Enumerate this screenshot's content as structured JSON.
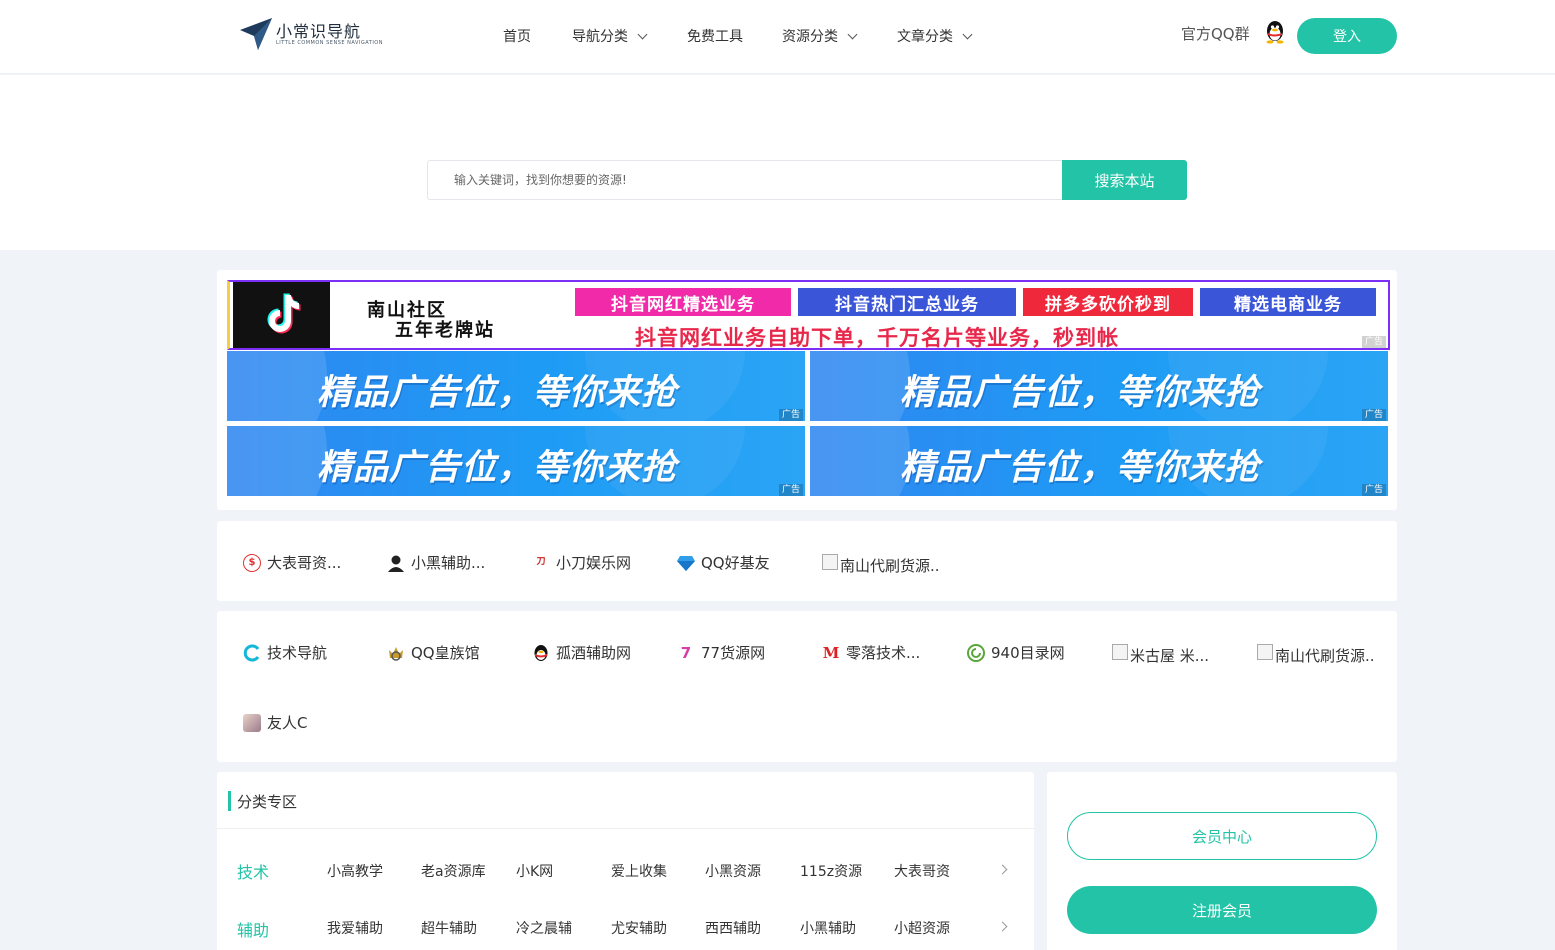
{
  "header": {
    "logo_title": "小常识导航",
    "logo_sub": "LITTLE COMMON SENSE NAVIGATION",
    "nav": [
      {
        "label": "首页"
      },
      {
        "label": "导航分类"
      },
      {
        "label": "免费工具"
      },
      {
        "label": "资源分类"
      },
      {
        "label": "文章分类"
      }
    ],
    "qq_group": "官方QQ群",
    "login": "登入"
  },
  "search": {
    "placeholder": "输入关键词，找到你想要的资源!",
    "button": "搜索本站"
  },
  "ads": {
    "top": {
      "title1": "南山社区",
      "title2": "五年老牌站",
      "tags": [
        "抖音网红精选业务",
        "抖音热门汇总业务",
        "拼多多砍价秒到",
        "精选电商业务"
      ],
      "slogan": "抖音网红业务自助下单，千万名片等业务，秒到帐",
      "tag_colors": [
        "#f02aa8",
        "#3b55d9",
        "#f0283c",
        "#3b55d9"
      ]
    },
    "ad_label": "广告",
    "banners": [
      "精品广告位，等你来抢",
      "精品广告位，等你来抢",
      "精品广告位，等你来抢",
      "精品广告位，等你来抢"
    ]
  },
  "links_featured": [
    {
      "name": "大表哥资...",
      "icon": "coin-icon"
    },
    {
      "name": "小黑辅助...",
      "icon": "hacker-icon"
    },
    {
      "name": "小刀娱乐网",
      "icon": "xiaodao-icon"
    },
    {
      "name": "QQ好基友",
      "icon": "diamond-icon"
    },
    {
      "name": "南山代刷货源..",
      "icon": "broken-image-icon"
    }
  ],
  "links_friends": [
    {
      "name": "技术导航",
      "icon": "c-logo-icon"
    },
    {
      "name": "QQ皇族馆",
      "icon": "crown-icon"
    },
    {
      "name": "孤酒辅助网",
      "icon": "qq-penguin-icon"
    },
    {
      "name": "77货源网",
      "icon": "seven-icon"
    },
    {
      "name": "零落技术...",
      "icon": "m-logo-icon"
    },
    {
      "name": "940目录网",
      "icon": "swirl-icon"
    },
    {
      "name": "米古屋 米...",
      "icon": "broken-image-icon"
    },
    {
      "name": "南山代刷货源..",
      "icon": "broken-image-icon"
    },
    {
      "name": "友人C",
      "icon": "anime-avatar-icon"
    }
  ],
  "category": {
    "title": "分类专区",
    "rows": [
      {
        "label": "技术",
        "items": [
          "小高教学",
          "老a资源库",
          "小K网",
          "爱上收集",
          "小黑资源",
          "115z资源",
          "大表哥资"
        ]
      },
      {
        "label": "辅助",
        "items": [
          "我爱辅助",
          "超牛辅助",
          "冷之晨辅",
          "尤安辅助",
          "西西辅助",
          "小黑辅助",
          "小超资源"
        ]
      }
    ]
  },
  "member": {
    "center": "会员中心",
    "register": "注册会员"
  },
  "colors": {
    "accent": "#22c3a6",
    "ad_blue": "#1e9cf5",
    "ad_red": "#e8284b"
  }
}
